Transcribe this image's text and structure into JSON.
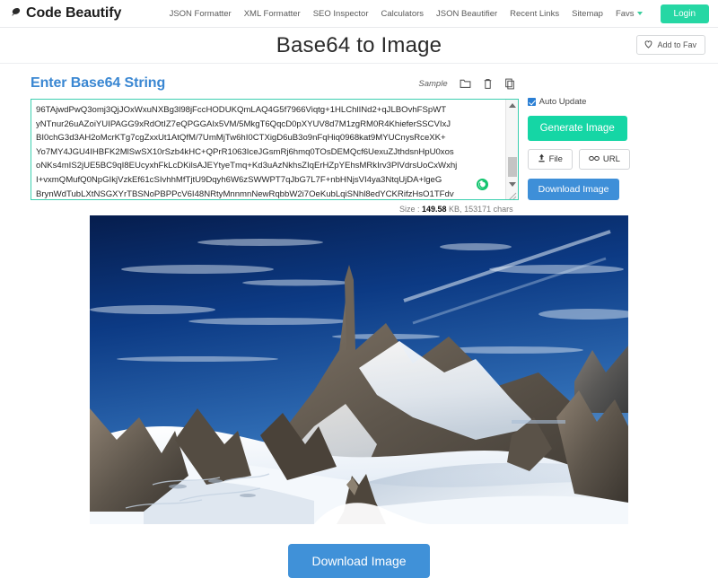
{
  "navbar": {
    "brand": "Code Beautify",
    "brand_icon": "feather-logo-icon",
    "links": [
      {
        "label": "JSON Formatter",
        "name": "nav-json-formatter"
      },
      {
        "label": "XML Formatter",
        "name": "nav-xml-formatter"
      },
      {
        "label": "SEO Inspector",
        "name": "nav-seo-inspector"
      },
      {
        "label": "Calculators",
        "name": "nav-calculators"
      },
      {
        "label": "JSON Beautifier",
        "name": "nav-json-beautifier"
      },
      {
        "label": "Recent Links",
        "name": "nav-recent-links"
      },
      {
        "label": "Sitemap",
        "name": "nav-sitemap"
      },
      {
        "label": "Favs",
        "name": "nav-favs",
        "has_caret": true
      }
    ],
    "login_label": "Login",
    "login_color": "#26d7a4"
  },
  "header": {
    "title": "Base64 to Image",
    "add_fav_label": "Add to Fav",
    "add_fav_icon": "heart-icon"
  },
  "editor": {
    "section_title": "Enter Base64 String",
    "section_title_color": "#3a87d2",
    "sample_label": "Sample",
    "tools": [
      {
        "name": "open-file-icon",
        "label": "folder-icon"
      },
      {
        "name": "clear-icon",
        "label": "trash-icon"
      },
      {
        "name": "copy-icon",
        "label": "copy-icon"
      }
    ],
    "border_color": "#3ccfb0",
    "lines": [
      "96TAjwdPwQ3omj3QjJOxWxuNXBg3l98jFccHODUKQmLAQ4G5f7966Viqtg+1HLChlINd2+qJLBOvhFSpWT",
      "yNTnur26uAZoiYUIPAGG9xRdOtIZ7eQPGGAIx5VM/5MkgT6QqcD0pXYUV8d7M1zgRM0R4KhieferSSCVIxJ",
      "BI0chG3d3AH2oMcrKTg7cgZxxUt1AtQfM/7UmMjTw6hI0CTXigD6uB3o9nFqHiq0968kat9MYUCnysRceXK+",
      "Yo7MY4JGU4IHBFK2MlSwSX10rSzb4kHC+QPrR1063IceJGsmRj6hmq0TOsDEMQcf6UexuZJthdsnHpU0xos",
      "oNKs4mIS2jUE5BC9qI8EUcyxhFkLcDKilsAJEYtyeTmq+Kd3uAzNkhsZIqErHZpYEhsMRkIrv3PlVdrsUoCxWxhj",
      "I+vxmQMufQ0NpGIkjVzkEf61cSIvhhMfTjtU9Dqyh6W6zSWWPT7qJbG7L7F+nbHNjsVI4ya3NtqUjDA+lgeG",
      "BrynWdTubLXtNSGXYrTBSNoPBPPcV6I48NRtyMnnmnNewRqbbW2i7OeKubLqiSNhl8edYCKRifzHsO1TFdv"
    ],
    "size_label": "Size :",
    "size_value": "149.58",
    "size_unit": "KB,",
    "chars_text": "153171 chars",
    "cursor_icon": "green-circle-cursor"
  },
  "controls": {
    "auto_update_label": "Auto Update",
    "auto_update_checked": true,
    "generate_label": "Generate Image",
    "generate_color": "#15d6a5",
    "file_label": "File",
    "file_icon": "upload-icon",
    "url_label": "URL",
    "url_icon": "link-icon",
    "download_small_label": "Download Image",
    "download_color": "#3e8fd8"
  },
  "preview": {
    "alt": "snow-covered alpine mountain peak under deep blue sky",
    "sky_color": "#0b3d87",
    "snow_color": "#eef3f8",
    "rock_color": "#6b6358"
  },
  "footer": {
    "download_label": "Download Image",
    "download_color": "#4091d8"
  }
}
